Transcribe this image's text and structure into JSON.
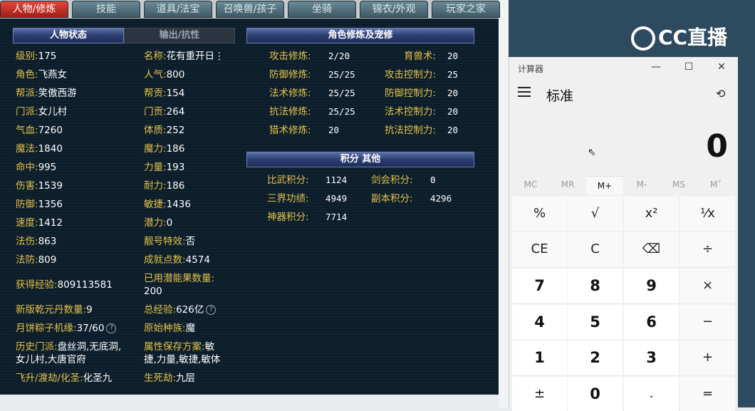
{
  "tabs": [
    "人物/修炼",
    "技能",
    "道具/法宝",
    "召唤兽/孩子",
    "坐骑",
    "锦衣/外观",
    "玩家之家"
  ],
  "status": {
    "active": "人物状态",
    "other": "输出/抗性"
  },
  "left": [
    [
      "级别:",
      "175"
    ],
    [
      "角色:",
      "飞燕女"
    ],
    [
      "帮派:",
      "笑傲西游"
    ],
    [
      "门派:",
      "女儿村"
    ],
    [
      "气血:",
      "7260"
    ],
    [
      "魔法:",
      "1840"
    ],
    [
      "命中:",
      "995"
    ],
    [
      "伤害:",
      "1539"
    ],
    [
      "防御:",
      "1356"
    ],
    [
      "速度:",
      "1412"
    ],
    [
      "法伤:",
      "863"
    ],
    [
      "法防:",
      "809"
    ]
  ],
  "mid": [
    [
      "名称:",
      "花有重开日⋮"
    ],
    [
      "人气:",
      "800"
    ],
    [
      "帮贡:",
      "154"
    ],
    [
      "门贡:",
      "264"
    ],
    [
      "体质:",
      "252"
    ],
    [
      "魔力:",
      "186"
    ],
    [
      "力量:",
      "193"
    ],
    [
      "耐力:",
      "186"
    ],
    [
      "敏捷:",
      "1436"
    ],
    [
      "潜力:",
      "0"
    ],
    [
      "靓号特效:",
      "否"
    ],
    [
      "成就点数:",
      "4574"
    ]
  ],
  "exp": {
    "label": "获得经验:",
    "value": "809113581"
  },
  "used": {
    "label": "已用潜能果数量:",
    "value": "200"
  },
  "elixir": {
    "label": "新版乾元丹数量:",
    "value": "9"
  },
  "totalexp": {
    "label": "总经验:",
    "value": "626亿"
  },
  "mooncake": {
    "label": "月饼粽子机缘:",
    "value": "37/60"
  },
  "race": {
    "label": "原始种族:",
    "value": "魔"
  },
  "history": {
    "label": "历史门派:",
    "value": "盘丝洞,无底洞,",
    "value2": "女儿村,大唐官府"
  },
  "plan": {
    "label": "属性保存方案:",
    "value": "敏",
    "value2": "捷,力量,敏捷,敏体"
  },
  "ascend": {
    "label": "飞升/渡劫/化圣:",
    "value": "化圣九"
  },
  "life": {
    "label": "生死劫:",
    "value": "九层"
  },
  "cultivation_title": "角色修炼及宠修",
  "cultivation": [
    [
      "攻击修炼:",
      "2/20",
      "育兽术:",
      "20"
    ],
    [
      "防御修炼:",
      "25/25",
      "攻击控制力:",
      "25"
    ],
    [
      "法术修炼:",
      "25/25",
      "防御控制力:",
      "20"
    ],
    [
      "抗法修炼:",
      "25/25",
      "法术控制力:",
      "20"
    ],
    [
      "猎术修炼:",
      "20",
      "抗法控制力:",
      "20"
    ]
  ],
  "score_title": "积分 其他",
  "scores": [
    [
      "比武积分:",
      "1124",
      "剑会积分:",
      "0"
    ],
    [
      "三界功绩:",
      "4949",
      "副本积分:",
      "4296"
    ],
    [
      "神器积分:",
      "7714",
      "",
      ""
    ]
  ],
  "logo": "CC直播",
  "calc": {
    "title": "计算器",
    "mode": "标准",
    "display": "0",
    "memory": [
      "MC",
      "MR",
      "M+",
      "M-",
      "MS",
      "M˅"
    ],
    "keys": [
      [
        "%",
        "√",
        "x²",
        "⅟x"
      ],
      [
        "CE",
        "C",
        "⌫",
        "÷"
      ],
      [
        "7",
        "8",
        "9",
        "×"
      ],
      [
        "4",
        "5",
        "6",
        "−"
      ],
      [
        "1",
        "2",
        "3",
        "+"
      ],
      [
        "±",
        "0",
        ".",
        "="
      ]
    ],
    "window_controls": [
      "—",
      "☐",
      "✕"
    ]
  }
}
